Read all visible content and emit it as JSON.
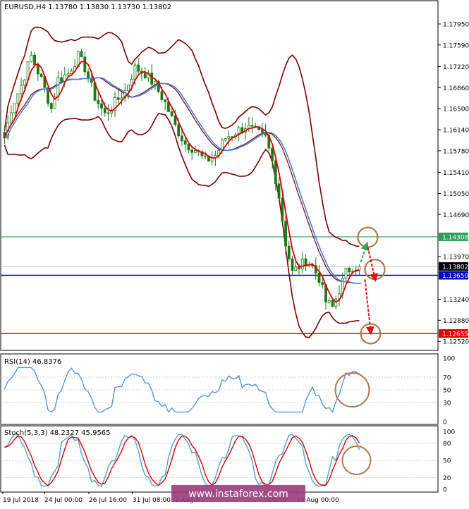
{
  "header": {
    "symbol": "EURUSD,H4",
    "ohlc": "1.13780 1.13830 1.13730 1.13802"
  },
  "watermark": "www.instaforex.com",
  "colors": {
    "candle": "#1a7a1a",
    "bollinger": "#7a0000",
    "ma_fast": "#e00000",
    "ma_slow": "#4a7ee0",
    "green_level": "#2e9e5a",
    "blue_level": "#0000c8",
    "red_level": "#e00000",
    "current_price": "#000000",
    "circle": "#b07850",
    "rsi_line": "#4a90e0",
    "stoch_main": "#4aa0e0",
    "stoch_signal": "#e00000"
  },
  "price_axis": {
    "ticks": [
      "1.17950",
      "1.17590",
      "1.17220",
      "1.16860",
      "1.16500",
      "1.16140",
      "1.15780",
      "1.15410",
      "1.15050",
      "1.14690",
      "1.13970",
      "1.13240",
      "1.12880",
      "1.12520"
    ],
    "levels": [
      {
        "label": "1.14308",
        "value": 1.14308,
        "color": "#2e9e5a"
      },
      {
        "label": "1.13802",
        "value": 1.13802,
        "color": "#000000"
      },
      {
        "label": "1.13650",
        "value": 1.1365,
        "color": "#0000c8"
      },
      {
        "label": "1.12655",
        "value": 1.12655,
        "color": "#e00000"
      }
    ]
  },
  "time_axis": [
    "19 Jul 2018",
    "24 Jul 00:00",
    "26 Jul 16:00",
    "31 Jul 08:00",
    "2 Aug 2",
    "",
    "10:00",
    "15 Aug 00:00"
  ],
  "rsi": {
    "label": "RSI(14) 46.8376",
    "ticks": [
      "100",
      "70",
      "50",
      "30",
      "0"
    ],
    "levels": [
      70,
      50,
      30
    ]
  },
  "stoch": {
    "label": "Stoch(5,3,3) 48.2327 45.9565",
    "ticks": [
      "100",
      "80",
      "50",
      "20",
      "0"
    ],
    "levels": [
      80,
      50,
      20
    ]
  },
  "chart_data": {
    "type": "candlestick",
    "title": "EURUSD,H4",
    "ylim": [
      1.1245,
      1.1807
    ],
    "price_anchors": [
      [
        0,
        1.16
      ],
      [
        2,
        1.165
      ],
      [
        5,
        1.169
      ],
      [
        8,
        1.174
      ],
      [
        11,
        1.17
      ],
      [
        14,
        1.165
      ],
      [
        16,
        1.17
      ],
      [
        19,
        1.171
      ],
      [
        22,
        1.174
      ],
      [
        24,
        1.172
      ],
      [
        27,
        1.167
      ],
      [
        30,
        1.164
      ],
      [
        33,
        1.166
      ],
      [
        36,
        1.168
      ],
      [
        39,
        1.172
      ],
      [
        42,
        1.171
      ],
      [
        45,
        1.169
      ],
      [
        48,
        1.166
      ],
      [
        51,
        1.162
      ],
      [
        54,
        1.159
      ],
      [
        57,
        1.158
      ],
      [
        60,
        1.156
      ],
      [
        63,
        1.157
      ],
      [
        66,
        1.16
      ],
      [
        69,
        1.161
      ],
      [
        72,
        1.162
      ],
      [
        75,
        1.161
      ],
      [
        78,
        1.16
      ],
      [
        80,
        1.156
      ],
      [
        82,
        1.15
      ],
      [
        84,
        1.142
      ],
      [
        86,
        1.137
      ],
      [
        88,
        1.138
      ],
      [
        90,
        1.139
      ],
      [
        92,
        1.138
      ],
      [
        94,
        1.136
      ],
      [
        96,
        1.132
      ],
      [
        98,
        1.131
      ],
      [
        100,
        1.134
      ],
      [
        102,
        1.137
      ],
      [
        104,
        1.138
      ],
      [
        106,
        1.13802
      ]
    ],
    "circles": [
      1.143,
      1.1375,
      1.1265
    ]
  }
}
